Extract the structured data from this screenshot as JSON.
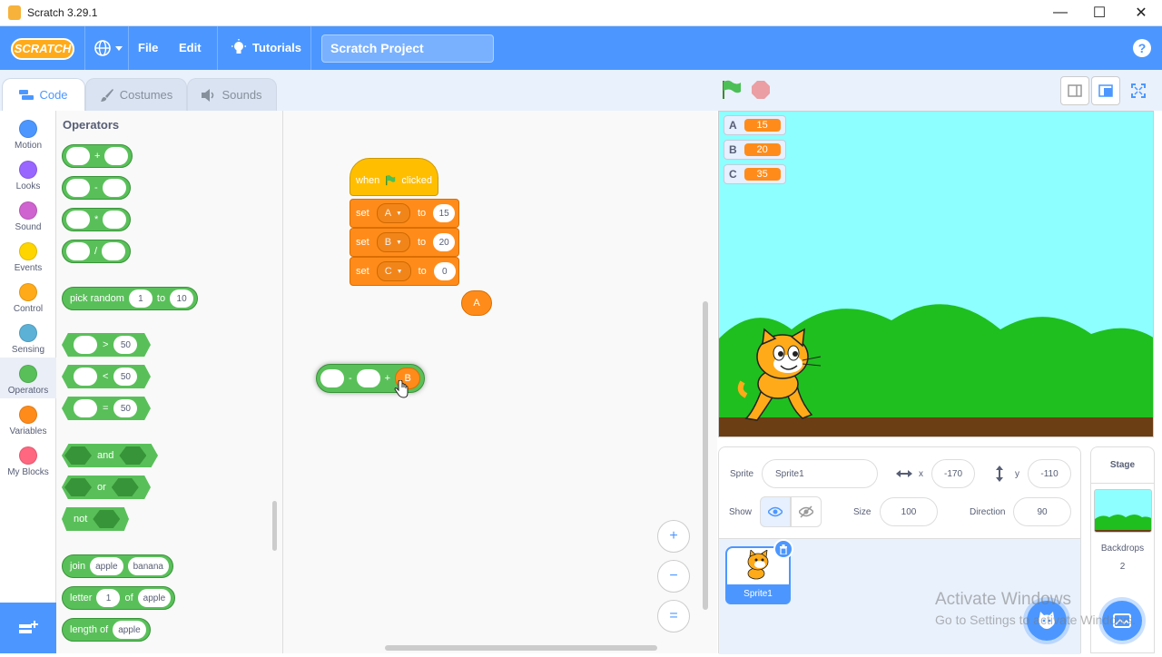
{
  "window": {
    "title": "Scratch 3.29.1",
    "min": "—",
    "max": "☐",
    "close": "✕"
  },
  "menubar": {
    "logo": "SCRATCH",
    "language_icon": "globe-icon",
    "file": "File",
    "edit": "Edit",
    "tutorials": "Tutorials",
    "project_title": "Scratch Project",
    "help": "?"
  },
  "tabs": {
    "code": "Code",
    "costumes": "Costumes",
    "sounds": "Sounds"
  },
  "categories": [
    {
      "label": "Motion",
      "color": "#4c97ff"
    },
    {
      "label": "Looks",
      "color": "#9966ff"
    },
    {
      "label": "Sound",
      "color": "#cf63cf"
    },
    {
      "label": "Events",
      "color": "#ffd500"
    },
    {
      "label": "Control",
      "color": "#ffab19"
    },
    {
      "label": "Sensing",
      "color": "#5cb1d6"
    },
    {
      "label": "Operators",
      "color": "#59c059"
    },
    {
      "label": "Variables",
      "color": "#ff8c1a"
    },
    {
      "label": "My Blocks",
      "color": "#ff6680"
    }
  ],
  "palette": {
    "title": "Operators",
    "op_add": "+",
    "op_sub": "-",
    "op_mul": "*",
    "op_div": "/",
    "pick_random": {
      "label": "pick random",
      "from": "1",
      "to_label": "to",
      "to": "10"
    },
    "gt": {
      "op": ">",
      "value": "50"
    },
    "lt": {
      "op": "<",
      "value": "50"
    },
    "eq": {
      "op": "=",
      "value": "50"
    },
    "and": "and",
    "or": "or",
    "not": "not",
    "join": {
      "label": "join",
      "a": "apple",
      "b": "banana"
    },
    "letter": {
      "label": "letter",
      "index": "1",
      "of_label": "of",
      "text": "apple"
    },
    "length": {
      "label": "length of",
      "text": "apple"
    }
  },
  "script": {
    "hat_when": "when",
    "hat_clicked": "clicked",
    "set_label": "set",
    "to_label": "to",
    "rows": [
      {
        "var": "A",
        "value": "15"
      },
      {
        "var": "B",
        "value": "20"
      },
      {
        "var": "C",
        "value": "0"
      }
    ],
    "loose_reporter": "A",
    "dragged_block": {
      "op": "-",
      "plus": "+",
      "var": "B"
    }
  },
  "zoom": {
    "in": "+",
    "out": "−",
    "reset": "="
  },
  "monitors": [
    {
      "name": "A",
      "value": "15"
    },
    {
      "name": "B",
      "value": "20"
    },
    {
      "name": "C",
      "value": "35"
    }
  ],
  "sprite_info": {
    "sprite_label": "Sprite",
    "sprite_name": "Sprite1",
    "x_label": "x",
    "x": "-170",
    "y_label": "y",
    "y": "-110",
    "show_label": "Show",
    "size_label": "Size",
    "size": "100",
    "direction_label": "Direction",
    "direction": "90"
  },
  "sprites": [
    {
      "name": "Sprite1"
    }
  ],
  "stage_panel": {
    "title": "Stage",
    "backdrops_label": "Backdrops",
    "backdrops_count": "2"
  },
  "watermark": {
    "line1": "Activate Windows",
    "line2": "Go to Settings to activate Windows."
  }
}
